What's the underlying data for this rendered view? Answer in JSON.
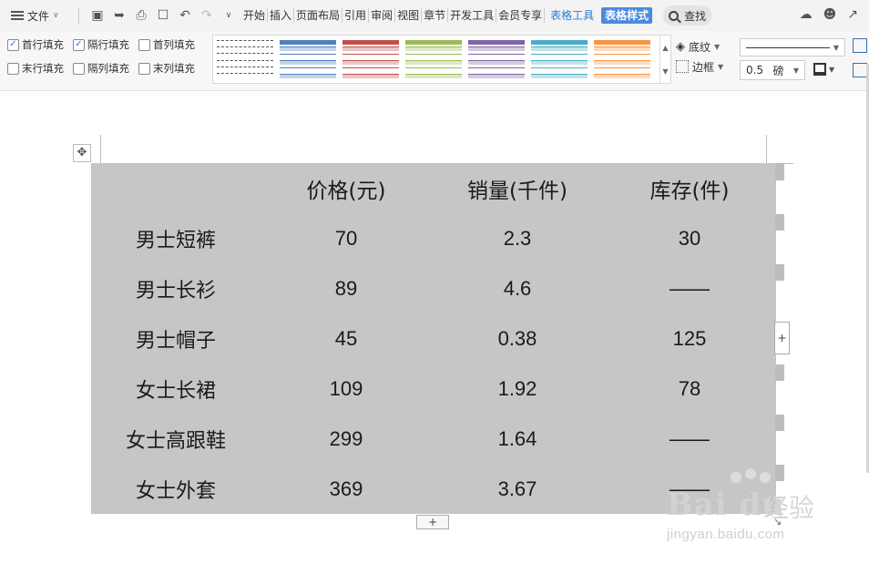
{
  "menubar": {
    "file_label": "文件",
    "tabs": [
      {
        "label": "开始"
      },
      {
        "label": "插入"
      },
      {
        "label": "页面布局"
      },
      {
        "label": "引用"
      },
      {
        "label": "审阅"
      },
      {
        "label": "视图"
      },
      {
        "label": "章节"
      },
      {
        "label": "开发工具"
      },
      {
        "label": "会员专享"
      }
    ],
    "table_tools_label": "表格工具",
    "table_style_label": "表格样式",
    "search_label": "查找"
  },
  "ribbon": {
    "checkboxes": [
      {
        "label": "首行填充",
        "checked": true
      },
      {
        "label": "隔行填充",
        "checked": true
      },
      {
        "label": "首列填充",
        "checked": false
      },
      {
        "label": "末行填充",
        "checked": false
      },
      {
        "label": "隔列填充",
        "checked": false
      },
      {
        "label": "末列填充",
        "checked": false
      }
    ],
    "style_swatches": [
      {
        "name": "plain",
        "color": "#555555"
      },
      {
        "name": "blue",
        "color": "#4f81bd"
      },
      {
        "name": "red",
        "color": "#c0504d"
      },
      {
        "name": "green",
        "color": "#9bbb59"
      },
      {
        "name": "purple",
        "color": "#8064a2"
      },
      {
        "name": "teal",
        "color": "#4bacc6"
      },
      {
        "name": "orange",
        "color": "#f79646"
      }
    ],
    "shading_label": "底纹",
    "border_label": "边框",
    "line_weight_value": "0.5",
    "line_weight_unit": "磅"
  },
  "table": {
    "headers": [
      "",
      "价格(元)",
      "销量(千件)",
      "库存(件)"
    ],
    "rows": [
      {
        "name": "男士短裤",
        "price": "70",
        "sales": "2.3",
        "stock": "30"
      },
      {
        "name": "男士长衫",
        "price": "89",
        "sales": "4.6",
        "stock": "——"
      },
      {
        "name": "男士帽子",
        "price": "45",
        "sales": "0.38",
        "stock": "125"
      },
      {
        "name": "女士长裙",
        "price": "109",
        "sales": "1.92",
        "stock": "78"
      },
      {
        "name": "女士高跟鞋",
        "price": "299",
        "sales": "1.64",
        "stock": "——"
      },
      {
        "name": "女士外套",
        "price": "369",
        "sales": "3.67",
        "stock": "——"
      }
    ],
    "background": "#c6c6c6"
  },
  "watermark": {
    "logo": "Bai du",
    "logo_suffix": "经验",
    "url": "jingyan.baidu.com"
  },
  "colors": {
    "accent": "#4a8be0",
    "tools_text": "#2b7bd6"
  }
}
